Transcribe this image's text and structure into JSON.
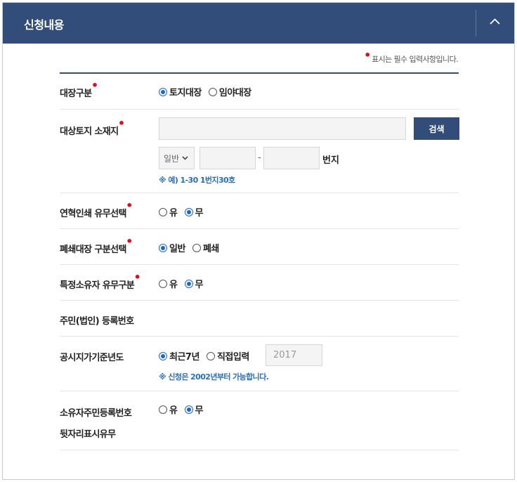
{
  "header": {
    "title": "신청내용"
  },
  "notice": {
    "text": "표시는 필수 입력사항입니다."
  },
  "rows": {
    "ledger_type": {
      "label": "대장구분",
      "options": [
        "토지대장",
        "임야대장"
      ],
      "selected": "토지대장"
    },
    "location": {
      "label": "대상토지 소재지",
      "search_label": "검색",
      "address_value": "",
      "type_select": "일반",
      "main_no": "",
      "dash": "-",
      "sub_no": "",
      "suffix": "번지",
      "hint": "※ 예) 1-30 1번지30호"
    },
    "history_print": {
      "label": "연혁인쇄 유무선택",
      "options": [
        "유",
        "무"
      ],
      "selected": "무"
    },
    "closed_ledger": {
      "label": "폐쇄대장 구분선택",
      "options": [
        "일반",
        "폐쇄"
      ],
      "selected": "일반"
    },
    "specific_owner": {
      "label": "특정소유자 유무구분",
      "options": [
        "유",
        "무"
      ],
      "selected": "무"
    },
    "resident_no": {
      "label": "주민(법인) 등록번호"
    },
    "base_year": {
      "label": "공시지가기준년도",
      "options": [
        "최근7년",
        "직접입력"
      ],
      "selected": "최근7년",
      "year_placeholder": "2017",
      "hint": "※ 신청은 2002년부터 가능합니다."
    },
    "owner_id_display": {
      "label_line1": "소유자주민등록번호",
      "label_line2": "뒷자리표시유무",
      "options": [
        "유",
        "무"
      ],
      "selected": "무"
    }
  },
  "colors": {
    "primary": "#334d7a",
    "required_dot": "#e00d1a",
    "radio_checked": "#1a66c9",
    "hint": "#2a6fb6"
  }
}
